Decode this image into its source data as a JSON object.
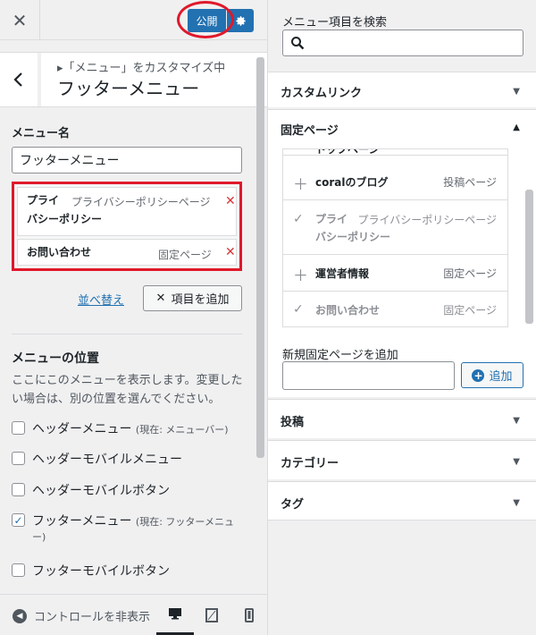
{
  "topbar": {
    "close_label": "✕",
    "publish_label": "公開",
    "settings_icon": "gear-icon"
  },
  "header": {
    "breadcrumb": "▸「メニュー」をカスタマイズ中",
    "title": "フッターメニュー"
  },
  "menu_name": {
    "label": "メニュー名",
    "value": "フッターメニュー"
  },
  "menu_items": [
    {
      "title_line1": "プライ",
      "title_line2": "バシーポリシー",
      "type": "プライバシーポリシーページ"
    },
    {
      "title_line1": "お問い合わせ",
      "title_line2": "",
      "type": "固定ページ"
    }
  ],
  "actions": {
    "reorder_label": "並べ替え",
    "add_item_label": "項目を追加"
  },
  "locations": {
    "heading": "メニューの位置",
    "description": "ここにこのメニューを表示します。変更したい場合は、別の位置を選んでください。",
    "options": [
      {
        "label": "ヘッダーメニュー",
        "note": "(現在: メニューバー)",
        "note_cont": "",
        "checked": false
      },
      {
        "label": "ヘッダーモバイルメニュー",
        "note": "",
        "note_cont": "",
        "checked": false
      },
      {
        "label": "ヘッダーモバイルボタン",
        "note": "",
        "note_cont": "",
        "checked": false
      },
      {
        "label": "フッターメニュー",
        "note": "(現在: フッターメニュ",
        "note_cont": "ー)",
        "checked": true
      },
      {
        "label": "フッターモバイルボタン",
        "note": "",
        "note_cont": "",
        "checked": false
      }
    ]
  },
  "footer": {
    "hide_controls_label": "コントロールを非表示"
  },
  "right": {
    "search_label": "メニュー項目を検索",
    "search_placeholder": "",
    "accordion": {
      "custom_link": "カスタムリンク",
      "pages": "固定ページ",
      "posts": "投稿",
      "categories": "カテゴリー",
      "tags": "タグ"
    },
    "partial_row": "トップページ",
    "pages": [
      {
        "title": "coralのブログ",
        "title2": "",
        "type": "投稿ページ",
        "added": false
      },
      {
        "title": "プライ",
        "title2": "バシーポリシー",
        "type": "プライバシーポリシーページ",
        "added": true
      },
      {
        "title": "運営者情報",
        "title2": "",
        "type": "固定ページ",
        "added": false
      },
      {
        "title": "お問い合わせ",
        "title2": "",
        "type": "固定ページ",
        "added": true
      }
    ],
    "new_page_label": "新規固定ページを追加",
    "new_page_value": "",
    "add_button_label": "追加"
  },
  "colors": {
    "accent": "#2271b1",
    "delete": "#d63638",
    "highlight": "#e0182b"
  }
}
